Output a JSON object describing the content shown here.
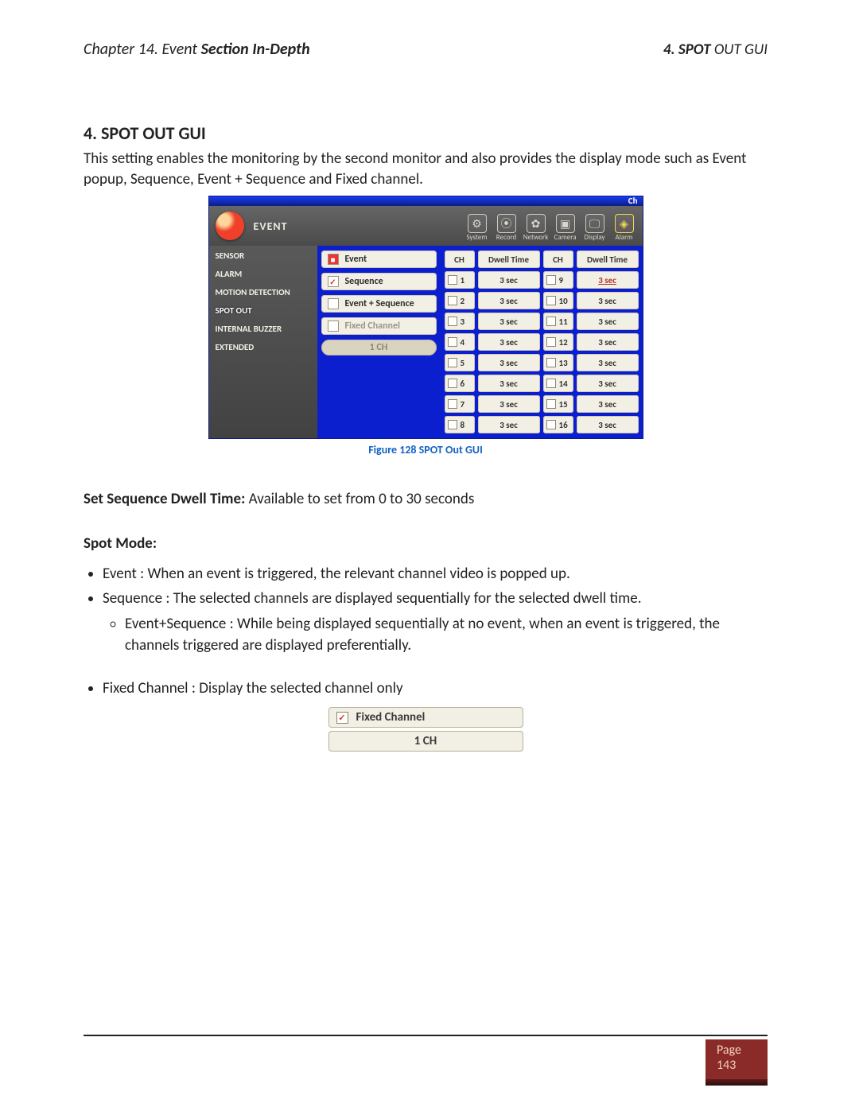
{
  "header": {
    "chapter_line_prefix": "Chapter 14. Event ",
    "chapter_line_bold": "Section In-Depth",
    "right_prefix_bold": "4. SPOT",
    "right_suffix": " OUT GUI"
  },
  "section": {
    "title": "4. SPOT OUT GUI",
    "intro": "This setting enables the monitoring by the second monitor and also provides the display mode such as Event popup, Sequence, Event + Sequence and Fixed channel."
  },
  "gui": {
    "titlebar_text": "Ch",
    "title": "EVENT",
    "toolbar": [
      {
        "name": "system",
        "label": "System",
        "glyph": "⚙"
      },
      {
        "name": "record",
        "label": "Record",
        "glyph": "⦿"
      },
      {
        "name": "network",
        "label": "Network",
        "glyph": "✿"
      },
      {
        "name": "camera",
        "label": "Camera",
        "glyph": "▣"
      },
      {
        "name": "display",
        "label": "Display",
        "glyph": "🖵"
      },
      {
        "name": "alarm",
        "label": "Alarm",
        "glyph": "◈",
        "active": true
      }
    ],
    "sidebar": [
      {
        "name": "sensor",
        "label": "SENSOR"
      },
      {
        "name": "alarm",
        "label": "ALARM"
      },
      {
        "name": "motion",
        "label": "MOTION DETECTION"
      },
      {
        "name": "spotout",
        "label": "SPOT OUT",
        "selected": true
      },
      {
        "name": "buzzer",
        "label": "INTERNAL BUZZER"
      },
      {
        "name": "extended",
        "label": "EXTENDED"
      }
    ],
    "modes": {
      "event": "Event",
      "sequence": "Sequence",
      "event_sequence": "Event + Sequence",
      "fixed_channel": "Fixed Channel",
      "ch_value": "1 CH"
    },
    "headers": {
      "ch": "CH",
      "dwell": "Dwell Time"
    },
    "rows": [
      {
        "ch": "1",
        "dwell": "3 sec",
        "ch2": "9",
        "dwell2": "3 sec",
        "dwell2_selected": true
      },
      {
        "ch": "2",
        "dwell": "3 sec",
        "ch2": "10",
        "dwell2": "3 sec"
      },
      {
        "ch": "3",
        "dwell": "3 sec",
        "ch2": "11",
        "dwell2": "3 sec"
      },
      {
        "ch": "4",
        "dwell": "3 sec",
        "ch2": "12",
        "dwell2": "3 sec"
      },
      {
        "ch": "5",
        "dwell": "3 sec",
        "ch2": "13",
        "dwell2": "3 sec"
      },
      {
        "ch": "6",
        "dwell": "3 sec",
        "ch2": "14",
        "dwell2": "3 sec"
      },
      {
        "ch": "7",
        "dwell": "3 sec",
        "ch2": "15",
        "dwell2": "3 sec"
      },
      {
        "ch": "8",
        "dwell": "3 sec",
        "ch2": "16",
        "dwell2": "3 sec"
      }
    ],
    "caption": "Figure 128 SPOT Out GUI"
  },
  "paragraphs": {
    "set_seq_bold": "Set Sequence Dwell Time: ",
    "set_seq_rest": "Available to set from 0 to 30 seconds",
    "spot_mode_label": "Spot Mode:",
    "items": [
      "Event : When an event is triggered, the relevant channel video is popped up.",
      "Sequence : The selected channels are displayed sequentially for the selected dwell time."
    ],
    "nested_item": "Event+Sequence : While being displayed sequentially at no event, when an event is triggered, the channels triggered are displayed preferentially.",
    "fixed_item": "Fixed Channel : Display the selected channel only"
  },
  "fixed_widget": {
    "label": "Fixed Channel",
    "value": "1 CH"
  },
  "footer": {
    "page_label": "Page",
    "page_number": "143"
  }
}
